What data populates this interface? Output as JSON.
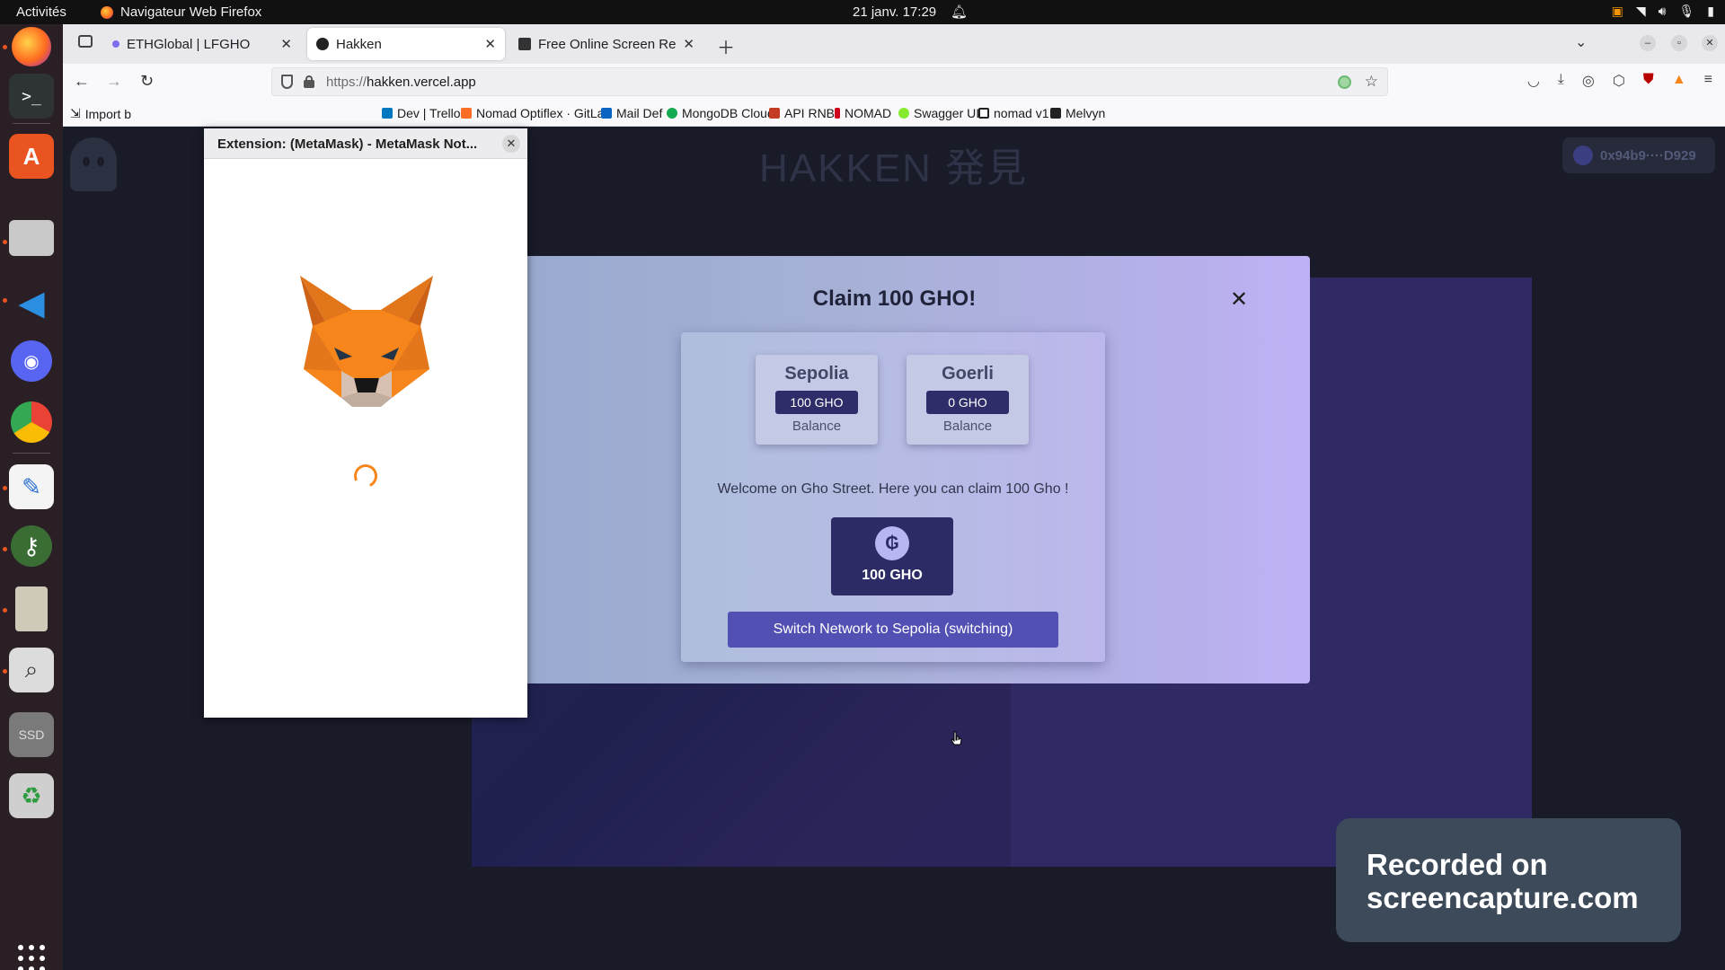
{
  "topbar": {
    "activities": "Activités",
    "app_name": "Navigateur Web Firefox",
    "clock": "21 janv.  17:29"
  },
  "browser": {
    "tabs": [
      {
        "label": "ETHGlobal | LFGHO",
        "active": false
      },
      {
        "label": "Hakken",
        "active": true
      },
      {
        "label": "Free Online Screen Reco",
        "active": false
      }
    ],
    "url_protocol": "https://",
    "url_host": "hakken.vercel.app",
    "bookmarks": [
      "Import b",
      "Dev | Trello",
      "Nomad Optiflex · GitLab",
      "Mail Def",
      "MongoDB Cloud",
      "API RNB",
      "NOMAD",
      "Swagger UI",
      "nomad v1",
      "Melvyn"
    ]
  },
  "page": {
    "title": "HAKKEN 発見",
    "wallet": "0x94b9····D929"
  },
  "modal": {
    "title": "Claim 100 GHO!",
    "networks": [
      {
        "name": "Sepolia",
        "balance": "100 GHO",
        "caption": "Balance"
      },
      {
        "name": "Goerli",
        "balance": "0 GHO",
        "caption": "Balance"
      }
    ],
    "welcome": "Welcome on Gho Street. Here you can claim 100 Gho !",
    "claim_amount": "100 GHO",
    "switch_button": "Switch Network to Sepolia (switching)"
  },
  "metamask": {
    "title": "Extension: (MetaMask) - MetaMask Not..."
  },
  "watermark": {
    "line1": "Recorded on",
    "line2": "screencapture.com"
  },
  "colors": {
    "modal_button": "#5350b4",
    "balance_badge": "#2e2d6a",
    "metamask_orange": "#f6851b"
  }
}
